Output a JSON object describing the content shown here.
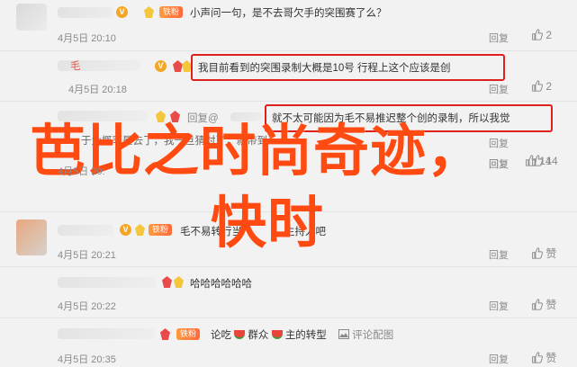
{
  "comments": [
    {
      "fan_badge": "铁粉",
      "text": "小声问一句，是不去哥欠手的突围赛了么？",
      "date": "4月5日 20:10",
      "reply_label": "回复",
      "like_count": "2"
    },
    {
      "name": "毛",
      "vip": "V",
      "text": "我目前看到的突围录制大概是10号 行程上这个应该是创",
      "date": "4月5日 20:18",
      "reply_label": "回复",
      "like_count": "2"
    },
    {
      "reply_prefix": "回复@",
      "text": "就不太可能因为毛不易推迟整个创的录制，所以我觉",
      "date": "4月5日 20:",
      "reply_label": "回复",
      "like_count": "14"
    },
    {
      "partial_text": "于大概率是去了，我一旦猜对了，就带到",
      "date": "",
      "reply_label": "回复"
    },
    {
      "vip": "V",
      "fan_badge": "铁粉",
      "text": "毛不易转行当",
      "text_tail": "主持人吧",
      "date": "4月5日 20:21",
      "reply_label": "回复",
      "like_count": "赞"
    },
    {
      "text": "哈哈哈哈哈哈",
      "date": "4月5日 20:22",
      "reply_label": "回复",
      "like_count": "赞"
    },
    {
      "fan_badge": "铁粉",
      "text_parts": [
        "论吃",
        "群众",
        "主的转型"
      ],
      "comment_pic_label": "评论配图",
      "date": "4月5日 20:35",
      "reply_label": "回复",
      "like_count": "赞"
    }
  ],
  "overlay": {
    "line1": "芭比之时尚奇迹，",
    "line2": "快时"
  },
  "colors": {
    "overlay": "#ff4a12",
    "highlight_box": "#e0201c",
    "background": "#f2f2f2"
  },
  "icons": [
    "thumbs-up-icon",
    "vip-v-icon",
    "medal-icon",
    "watermelon-icon",
    "image-icon"
  ]
}
